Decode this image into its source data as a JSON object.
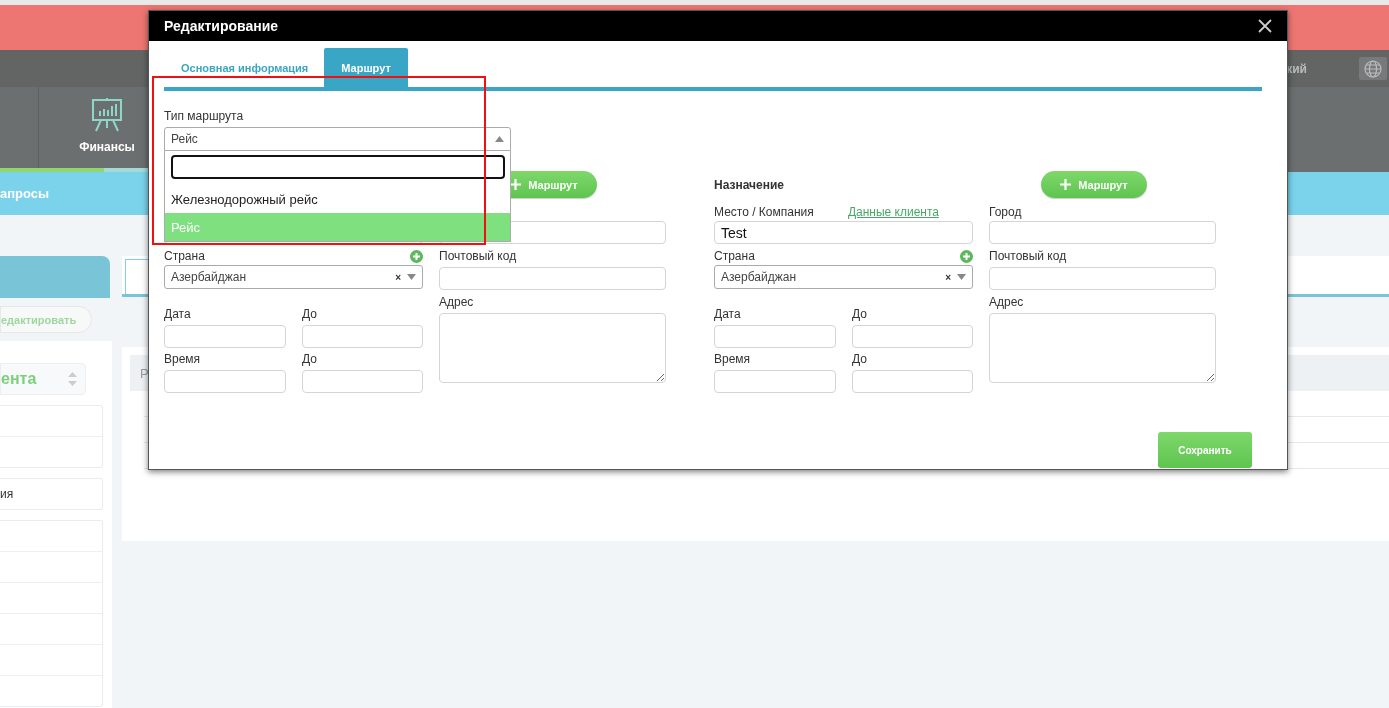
{
  "background": {
    "language_label": "кий",
    "nav_item": "Финансы",
    "subnav_item": "апросы",
    "edit_button": "едактировать",
    "client_select": "ента",
    "list_item": "ия",
    "table_header_cell": "Р"
  },
  "dialog": {
    "title": "Редактирование",
    "tabs": [
      {
        "label": "Основная информация",
        "selected": false
      },
      {
        "label": "Маршрут",
        "selected": true
      }
    ],
    "route_type": {
      "label": "Тип маршрута",
      "value": "Рейс",
      "expanded": true,
      "options": [
        {
          "label": "Железнодорожный рейс",
          "selected": false
        },
        {
          "label": "Рейс",
          "selected": true
        }
      ]
    },
    "sections": [
      {
        "add_button": "Маршрут",
        "country_label": "Страна",
        "country_value": "Азербайджан",
        "country_clear": "×",
        "postal_label": "Почтовый код",
        "address_label": "Адрес",
        "date_label": "Дата",
        "date_to_label": "До",
        "time_label": "Время",
        "time_to_label": "До"
      },
      {
        "heading": "Назначение",
        "add_button": "Маршрут",
        "place_label": "Место / Компания",
        "client_link": "Данные клиента",
        "place_value": "Test",
        "city_label": "Город",
        "country_label": "Страна",
        "country_value": "Азербайджан",
        "country_clear": "×",
        "postal_label": "Почтовый код",
        "address_label": "Адрес",
        "date_label": "Дата",
        "date_to_label": "До",
        "time_label": "Время",
        "time_to_label": "До"
      }
    ],
    "save_button": "Сохранить"
  }
}
